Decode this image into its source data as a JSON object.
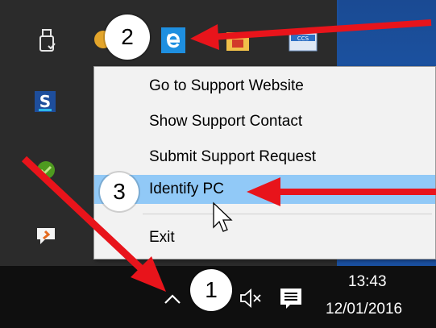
{
  "tray_icons": [
    {
      "icon": "usb-drive-icon"
    },
    {
      "icon": "support-app-icon"
    },
    {
      "icon": "edge-e-icon"
    },
    {
      "icon": "network-folder-icon"
    },
    {
      "icon": "ccs-app-icon"
    },
    {
      "icon": "s-app-icon"
    },
    {
      "icon": "green-app-icon"
    },
    {
      "icon": "chat-bubble-icon"
    }
  ],
  "context_menu": {
    "items": [
      {
        "label": "Go to Support Website"
      },
      {
        "label": "Show Support Contact"
      },
      {
        "label": "Submit Support Request"
      },
      {
        "label": "Identify PC",
        "highlighted": true
      },
      {
        "label": "Exit"
      }
    ]
  },
  "taskbar": {
    "show_hidden_icons_glyph": "^",
    "volume_glyph": "🔇",
    "notification_icon": "action-center-icon",
    "time": "13:43",
    "date": "12/01/2016"
  },
  "annotations": {
    "step1": "1",
    "step2": "2",
    "step3": "3",
    "arrow_color": "#e8141b"
  },
  "colors": {
    "menu_highlight": "#91c9f7",
    "flyout_bg": "#2b2b2b",
    "taskbar_bg": "#0f0f0f"
  }
}
